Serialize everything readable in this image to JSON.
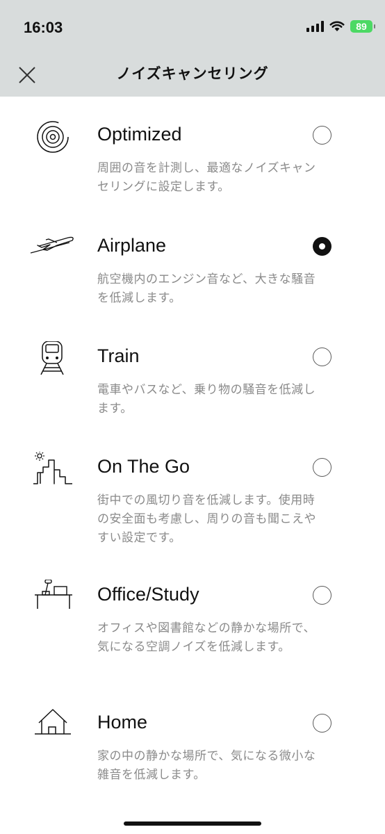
{
  "status_bar": {
    "time": "16:03",
    "battery": "89",
    "icons": [
      "signal-icon",
      "wifi-icon",
      "battery-icon"
    ]
  },
  "header": {
    "title": "ノイズキャンセリング",
    "close_icon": "close-icon"
  },
  "options": [
    {
      "title": "Optimized",
      "description": "周囲の音を計測し、最適なノイズキャンセリングに設定します。",
      "icon": "optimized-icon",
      "selected": false
    },
    {
      "title": "Airplane",
      "description": "航空機内のエンジン音など、大きな騒音を低減します。",
      "icon": "airplane-icon",
      "selected": true
    },
    {
      "title": "Train",
      "description": "電車やバスなど、乗り物の騒音を低減します。",
      "icon": "train-icon",
      "selected": false
    },
    {
      "title": "On The Go",
      "description": "街中での風切り音を低減します。使用時の安全面も考慮し、周りの音も聞こえやすい設定です。",
      "icon": "city-icon",
      "selected": false
    },
    {
      "title": "Office/Study",
      "description": "オフィスや図書館などの静かな場所で、気になる空調ノイズを低減します。",
      "icon": "office-icon",
      "selected": false
    },
    {
      "title": "Home",
      "description": "家の中の静かな場所で、気になる微小な雑音を低減します。",
      "icon": "home-icon",
      "selected": false
    }
  ],
  "colors": {
    "header_bg": "#d8dcdc",
    "battery_green": "#4cd964",
    "description_gray": "#8a8a8a"
  }
}
